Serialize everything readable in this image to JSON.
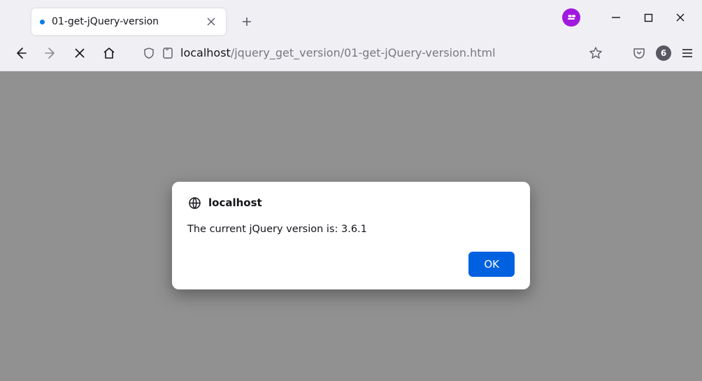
{
  "tab": {
    "title": "01-get-jQuery-version"
  },
  "url": {
    "host": "localhost",
    "path": "/jquery_get_version/01-get-jQuery-version.html"
  },
  "toolbar": {
    "badge_count": "6"
  },
  "dialog": {
    "origin": "localhost",
    "message": "The current jQuery version is: 3.6.1",
    "ok_label": "OK"
  }
}
